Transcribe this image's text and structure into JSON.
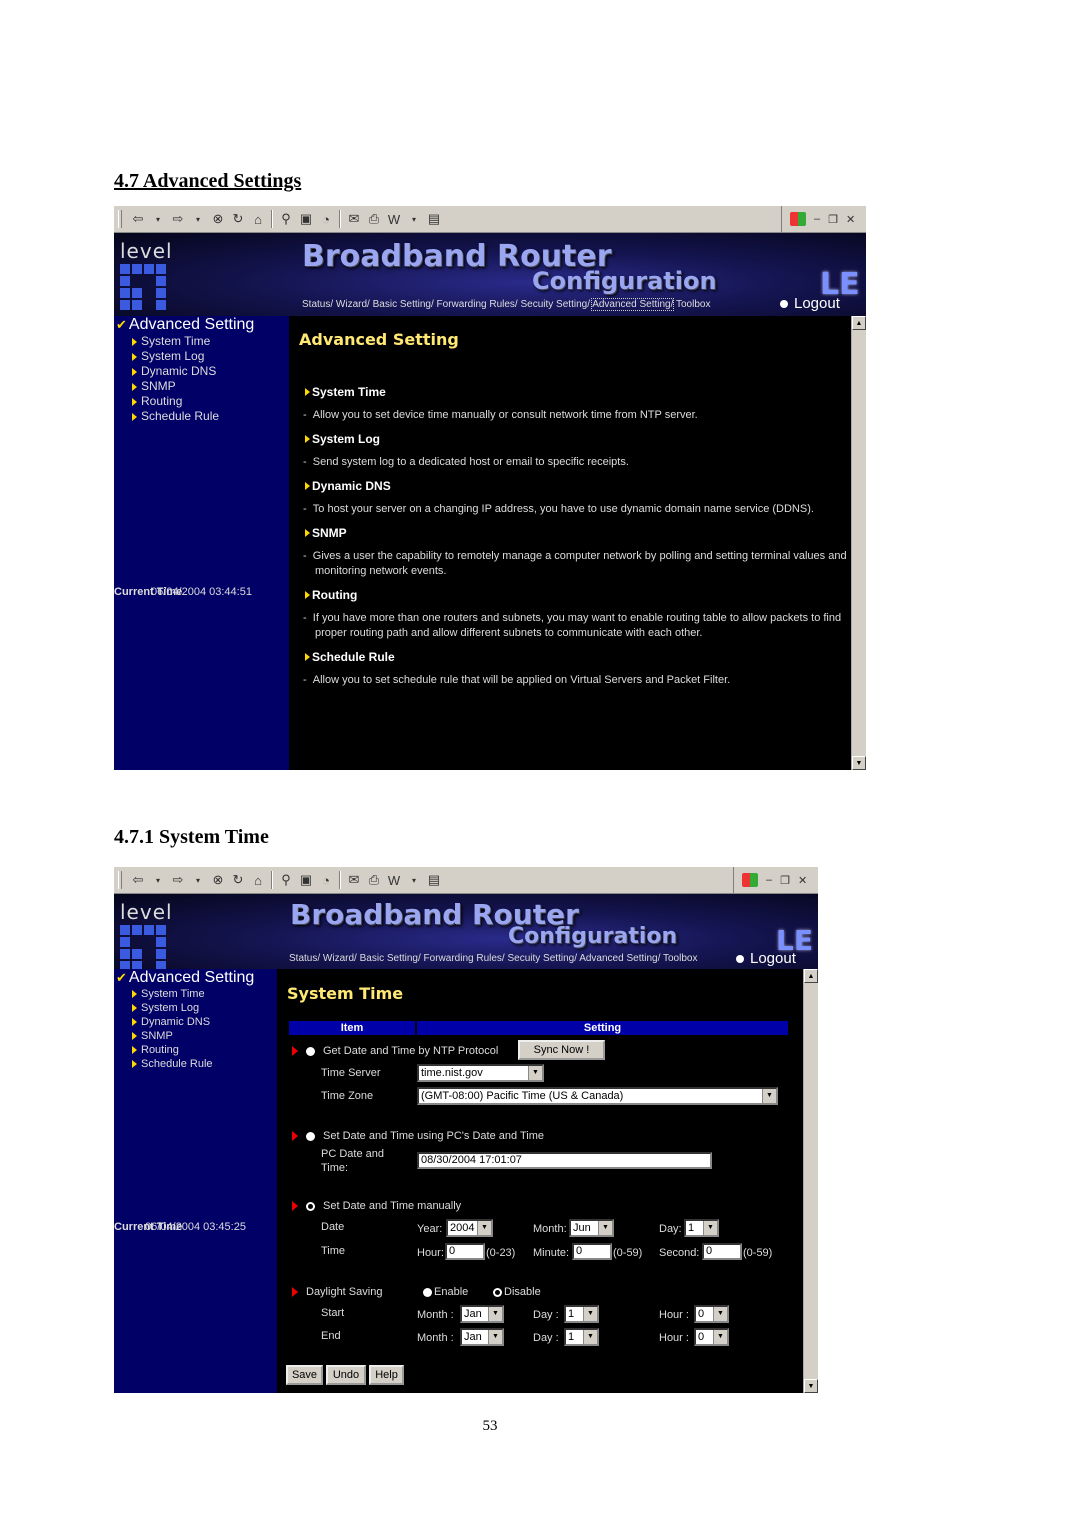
{
  "doc": {
    "section1_heading": "4.7 Advanced Settings",
    "section2_heading": "4.7.1 System Time",
    "page_number": "53"
  },
  "browser": {
    "toolbar_icons": [
      "back-icon",
      "dropdown-icon",
      "forward-icon",
      "dropdown-icon",
      "stop-icon",
      "refresh-icon",
      "home-icon",
      "search-icon",
      "favorites-icon",
      "history-icon",
      "mail-icon",
      "print-icon",
      "edit-icon",
      "discuss-icon"
    ],
    "window_controls": [
      "minimize",
      "restore",
      "close"
    ]
  },
  "header": {
    "logo_text": "level",
    "banner_title": "Broadband Router",
    "banner_subtitle": "Configuration",
    "brand_partial": "LE",
    "nav": [
      {
        "label": "Status/"
      },
      {
        "label": "Wizard/"
      },
      {
        "label": "Basic Setting/"
      },
      {
        "label": "Forwarding Rules/"
      },
      {
        "label": "Secuity Setting/"
      },
      {
        "label": "Advanced Setting/"
      },
      {
        "label": "Toolbox"
      }
    ],
    "logout_label": "Logout"
  },
  "sidebar": {
    "title": "Advanced Setting",
    "items": [
      {
        "label": "System Time"
      },
      {
        "label": "System Log"
      },
      {
        "label": "Dynamic DNS"
      },
      {
        "label": "SNMP"
      },
      {
        "label": "Routing"
      },
      {
        "label": "Schedule Rule"
      }
    ],
    "current_time_label": "Current Time"
  },
  "screen1": {
    "current_time": "06/04/2004 03:44:51",
    "page_title": "Advanced Setting",
    "sections": [
      {
        "title": "System Time",
        "desc": "Allow you to set device time manually or consult network time from NTP server."
      },
      {
        "title": "System Log",
        "desc": "Send system log to a dedicated host or email to specific receipts."
      },
      {
        "title": "Dynamic DNS",
        "desc": "To host your server on a changing IP address, you have to use dynamic domain name service (DDNS)."
      },
      {
        "title": "SNMP",
        "desc": "Gives a user the capability to remotely manage a computer network by polling and setting terminal values and monitoring network events."
      },
      {
        "title": "Routing",
        "desc": "If you have more than one routers and subnets, you may want to enable routing table to allow packets to find proper routing path and allow different subnets to communicate with each other."
      },
      {
        "title": "Schedule Rule",
        "desc": "Allow you to set schedule rule that will be applied on Virtual Servers and Packet Filter."
      }
    ]
  },
  "screen2": {
    "current_time": "06/04/2004 03:45:25",
    "page_title": "System Time",
    "table_headers": [
      "Item",
      "Setting"
    ],
    "ntp": {
      "option_label": "Get Date and Time by NTP Protocol",
      "selected": false,
      "sync_button": "Sync Now !",
      "time_server_label": "Time Server",
      "time_server_value": "time.nist.gov",
      "time_zone_label": "Time Zone",
      "time_zone_value": "(GMT-08:00) Pacific Time (US & Canada)"
    },
    "pc": {
      "option_label": "Set Date and Time using PC's Date and Time",
      "selected": false,
      "pc_label_line1": "PC Date and",
      "pc_label_line2": "Time:",
      "pc_value": "08/30/2004 17:01:07"
    },
    "manual": {
      "option_label": "Set Date and Time manually",
      "selected": true,
      "date_label": "Date",
      "year_label": "Year:",
      "year_value": "2004",
      "month_label": "Month:",
      "month_value": "Jun",
      "day_label": "Day:",
      "day_value": "1",
      "time_label": "Time",
      "hour_label": "Hour:",
      "hour_value": "0",
      "hour_range": "(0-23)",
      "minute_label": "Minute:",
      "minute_value": "0",
      "minute_range": "(0-59)",
      "second_label": "Second:",
      "second_value": "0",
      "second_range": "(0-59)"
    },
    "dst": {
      "label": "Daylight Saving",
      "enable_label": "Enable",
      "disable_label": "Disable",
      "enabled": false,
      "start_label": "Start",
      "end_label": "End",
      "month_label": "Month :",
      "day_label": "Day :",
      "hour_label": "Hour :",
      "start_month": "Jan",
      "start_day": "1",
      "start_hour": "0",
      "end_month": "Jan",
      "end_day": "1",
      "end_hour": "0"
    },
    "buttons": {
      "save": "Save",
      "undo": "Undo",
      "help": "Help"
    }
  }
}
